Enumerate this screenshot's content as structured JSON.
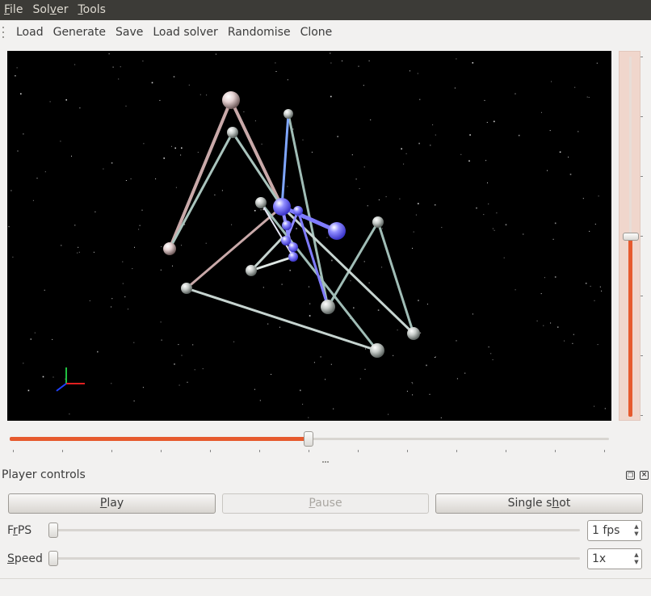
{
  "menubar": {
    "items": [
      {
        "label_mnemonic": "F",
        "label_rest": "ile"
      },
      {
        "label_pre": "Sol",
        "label_mnemonic": "v",
        "label_rest": "er"
      },
      {
        "label_mnemonic": "T",
        "label_rest": "ools"
      }
    ]
  },
  "toolbar": {
    "load": "Load",
    "generate": "Generate",
    "save": "Save",
    "load_solver": "Load solver",
    "randomise": "Randomise",
    "clone": "Clone"
  },
  "viewport": {
    "background": "#000000",
    "axis_colors": {
      "x": "#e02020",
      "y": "#20c040",
      "z": "#2040ff"
    },
    "accent_ball_color": "#6f6cff"
  },
  "timeline_slider": {
    "value_fraction": 0.5
  },
  "zoom_slider": {
    "value_fraction": 0.5
  },
  "player_controls": {
    "title": "Player controls",
    "float_icon": "restore-icon",
    "close_icon": "close-icon",
    "play": {
      "mnemonic": "P",
      "rest": "lay"
    },
    "pause": {
      "mnemonic": "P",
      "rest": "ause",
      "disabled": true
    },
    "single_shot": {
      "pre": "Single s",
      "mnemonic": "h",
      "rest": "ot"
    },
    "fps": {
      "pre": "F",
      "mnemonic": "r",
      "rest": "PS",
      "value": "1 fps",
      "slider_fraction": 0.0
    },
    "speed": {
      "mnemonic": "S",
      "rest": "peed",
      "value": "1x",
      "slider_fraction": 0.0
    }
  }
}
